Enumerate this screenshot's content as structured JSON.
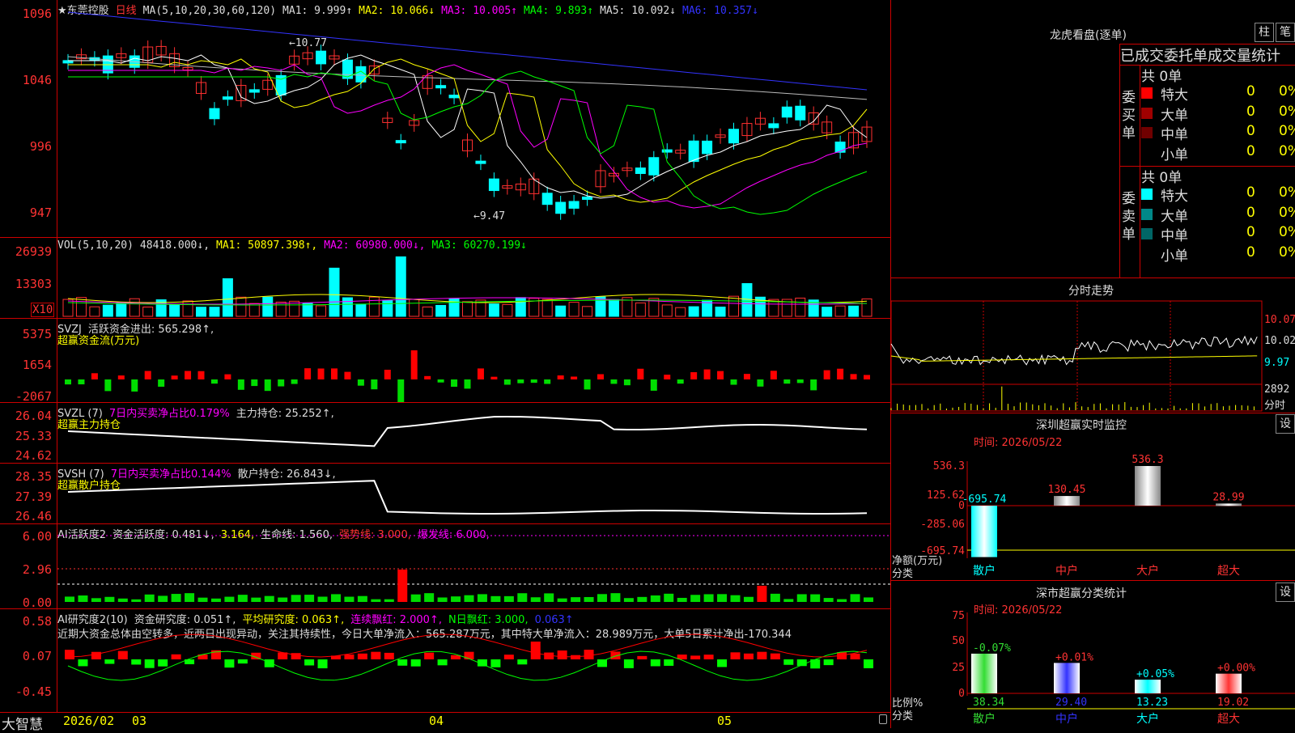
{
  "stock": {
    "name": "★东莞控股",
    "period": "日线",
    "ma_label": "MA(5,10,20,30,60,120)",
    "ma1": "MA1: 9.999↑",
    "ma2": "MA2: 10.066↓",
    "ma3": "MA3: 10.005↑",
    "ma4": "MA4: 9.893↑",
    "ma5": "MA5: 10.092↓",
    "ma6": "MA6: 10.357↓",
    "high_mark": "10.77",
    "low_mark": "9.47",
    "y_labels": [
      "1096",
      "1046",
      "996",
      "947"
    ]
  },
  "vol": {
    "label": "VOL(5,10,20)",
    "value": "48418.000↓,",
    "ma1": "MA1: 50897.398↑,",
    "ma2": "MA2: 60980.000↓,",
    "ma3": "MA3: 60270.199↓",
    "y_labels": [
      "26939",
      "13303"
    ],
    "unit": "X10"
  },
  "svzj": {
    "label": "SVZJ",
    "text": "活跃资金进出: 565.298↑,",
    "sub": "超赢资金流(万元)",
    "y_labels": [
      "5375",
      "1654",
      "-2067"
    ]
  },
  "svzl": {
    "label": "SVZL (7)",
    "text1": "7日内买卖净占比0.179%",
    "text2": "主力持仓: 25.252↑,",
    "sub": "超赢主力持仓",
    "y_labels": [
      "26.04",
      "25.33",
      "24.62"
    ]
  },
  "svsh": {
    "label": "SVSH (7)",
    "text1": "7日内买卖净占比0.144%",
    "text2": "散户持仓: 26.843↓,",
    "sub": "超赢散户持仓",
    "y_labels": [
      "28.35",
      "27.39",
      "26.46"
    ]
  },
  "ai1": {
    "label": "AI活跃度2",
    "text1": "资金活跃度: 0.481↓,",
    "text2": "3.164,",
    "text3": "生命线: 1.560,",
    "text4": "强势线: 3.000,",
    "text5": "爆发线: 6.000,",
    "y_labels": [
      "6.00",
      "2.96",
      "0.00"
    ]
  },
  "ai2": {
    "label": "AI研究度2(10)",
    "text1": "资金研究度: 0.051↑,",
    "text2": "平均研究度: 0.063↑,",
    "text3": "连续飘红: 2.000↑,",
    "text4": "N日飘红: 3.000,",
    "text5": "0.063↑",
    "comment": "近期大资金总体由空转多，近两日出现异动，关注其持续性，今日大单净流入：565.287万元，其中特大单净流入：28.989万元，大单5日累计净出-170.344",
    "y_labels": [
      "0.58",
      "0.07",
      "-0.45"
    ]
  },
  "dates": {
    "brand": "大智慧",
    "d1": "2026/02",
    "d2": "03",
    "d3": "04",
    "d4": "05"
  },
  "longhu": {
    "title": "龙虎看盘(逐单)",
    "btn1": "柱",
    "btn2": "笔",
    "subtitle": "已成交委托单成交量统计",
    "buy_side": "委买单",
    "sell_side": "委卖单",
    "buy_total": "共 0单",
    "sell_total": "共 0单",
    "buy_rows": [
      {
        "name": "特大",
        "v1": "0",
        "v2": "0%",
        "color": "#ff0000"
      },
      {
        "name": "大单",
        "v1": "0",
        "v2": "0%",
        "color": "#a00000"
      },
      {
        "name": "中单",
        "v1": "0",
        "v2": "0%",
        "color": "#700000"
      },
      {
        "name": "小单",
        "v1": "0",
        "v2": "0%",
        "color": "#000000"
      }
    ],
    "sell_rows": [
      {
        "name": "特大",
        "v1": "0",
        "v2": "0%",
        "color": "#00ffff"
      },
      {
        "name": "大单",
        "v1": "0",
        "v2": "0%",
        "color": "#008888"
      },
      {
        "name": "中单",
        "v1": "0",
        "v2": "0%",
        "color": "#006666"
      },
      {
        "name": "小单",
        "v1": "0",
        "v2": "0%",
        "color": "#000000"
      }
    ]
  },
  "fenshi": {
    "title": "分时走势",
    "y_labels": [
      "10.07",
      "10.02",
      "9.97"
    ],
    "vol_label": "2892",
    "sub": "分时"
  },
  "sz_monitor": {
    "title": "深圳超赢实时监控",
    "btn": "设",
    "time": "时间: 2026/05/22",
    "y_labels": [
      "536.3",
      "125.62",
      "0",
      "-285.06",
      "-695.74"
    ],
    "ylabel": "净额(万元)",
    "xlabel": "分类",
    "categories": [
      "散户",
      "中户",
      "大户",
      "超大"
    ],
    "values": [
      -695.74,
      130.45,
      536.3,
      28.99
    ],
    "value_labels": [
      "-695.74",
      "130.45",
      "536.3",
      "28.99"
    ]
  },
  "sz_class": {
    "title": "深市超赢分类统计",
    "btn": "设",
    "time": "时间: 2026/05/22",
    "y_labels": [
      "75",
      "50",
      "25",
      "0"
    ],
    "ylabel": "比例%",
    "xlabel": "分类",
    "categories": [
      "散户",
      "中户",
      "大户",
      "超大"
    ],
    "values": [
      38.34,
      29.4,
      13.23,
      19.02
    ],
    "bottom_labels": [
      "38.34",
      "29.40",
      "13.23",
      "19.02"
    ],
    "top_labels": [
      "-0.07%",
      "+0.01%",
      "+0.05%",
      "+0.00%"
    ],
    "colors": [
      "#33dd33",
      "#3333ff",
      "#00ffff",
      "#ff3333"
    ]
  }
}
